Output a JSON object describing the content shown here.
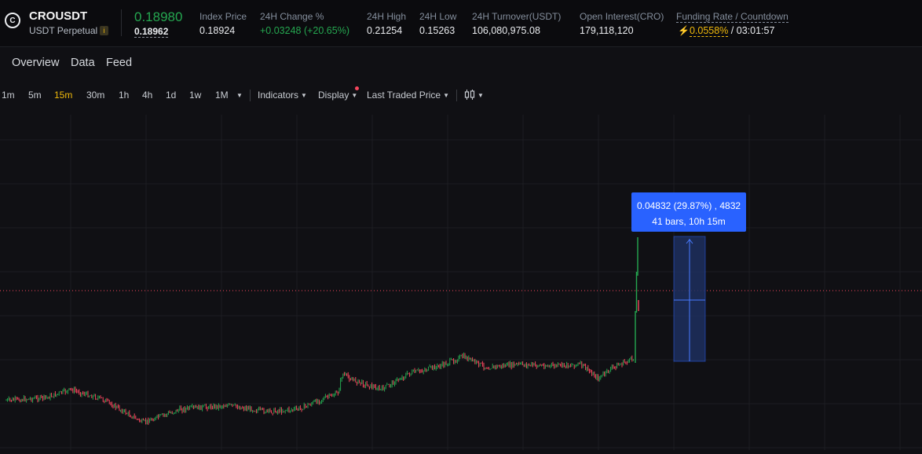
{
  "ticker": {
    "logo_glyph": "C",
    "symbol": "CROUSDT",
    "contract_type": "USDT Perpetual",
    "info_icon": "i",
    "last_price": "0.18980",
    "mark_price": "0.18962"
  },
  "stats": [
    {
      "label": "Index Price",
      "value": "0.18924"
    },
    {
      "label": "24H Change %",
      "value": "+0.03248 (+20.65%)"
    },
    {
      "label": "24H High",
      "value": "0.21254"
    },
    {
      "label": "24H Low",
      "value": "0.15263"
    },
    {
      "label": "24H Turnover(USDT)",
      "value": "106,080,975.08"
    },
    {
      "label": "Open Interest(CRO)",
      "value": "179,118,120"
    }
  ],
  "funding": {
    "label": "Funding Rate / Countdown",
    "rate": "0.0558%",
    "separator": "/",
    "countdown": "03:01:57"
  },
  "subnav": [
    "Overview",
    "Data",
    "Feed"
  ],
  "timeframes": [
    "1m",
    "5m",
    "15m",
    "30m",
    "1h",
    "4h",
    "1d",
    "1w",
    "1M"
  ],
  "active_timeframe": "15m",
  "toolbar": {
    "indicators": "Indicators",
    "display": "Display",
    "price_type": "Last Traded Price",
    "chart_type_icon": "candlestick-icon"
  },
  "measure_tooltip": {
    "line1": "0.04832 (29.87%) , 4832",
    "line2": "41 bars, 10h 15m"
  },
  "colors": {
    "up": "#25a750",
    "down": "#f6465d",
    "accent": "#f0b90b",
    "tooltip": "#2962ff"
  }
}
